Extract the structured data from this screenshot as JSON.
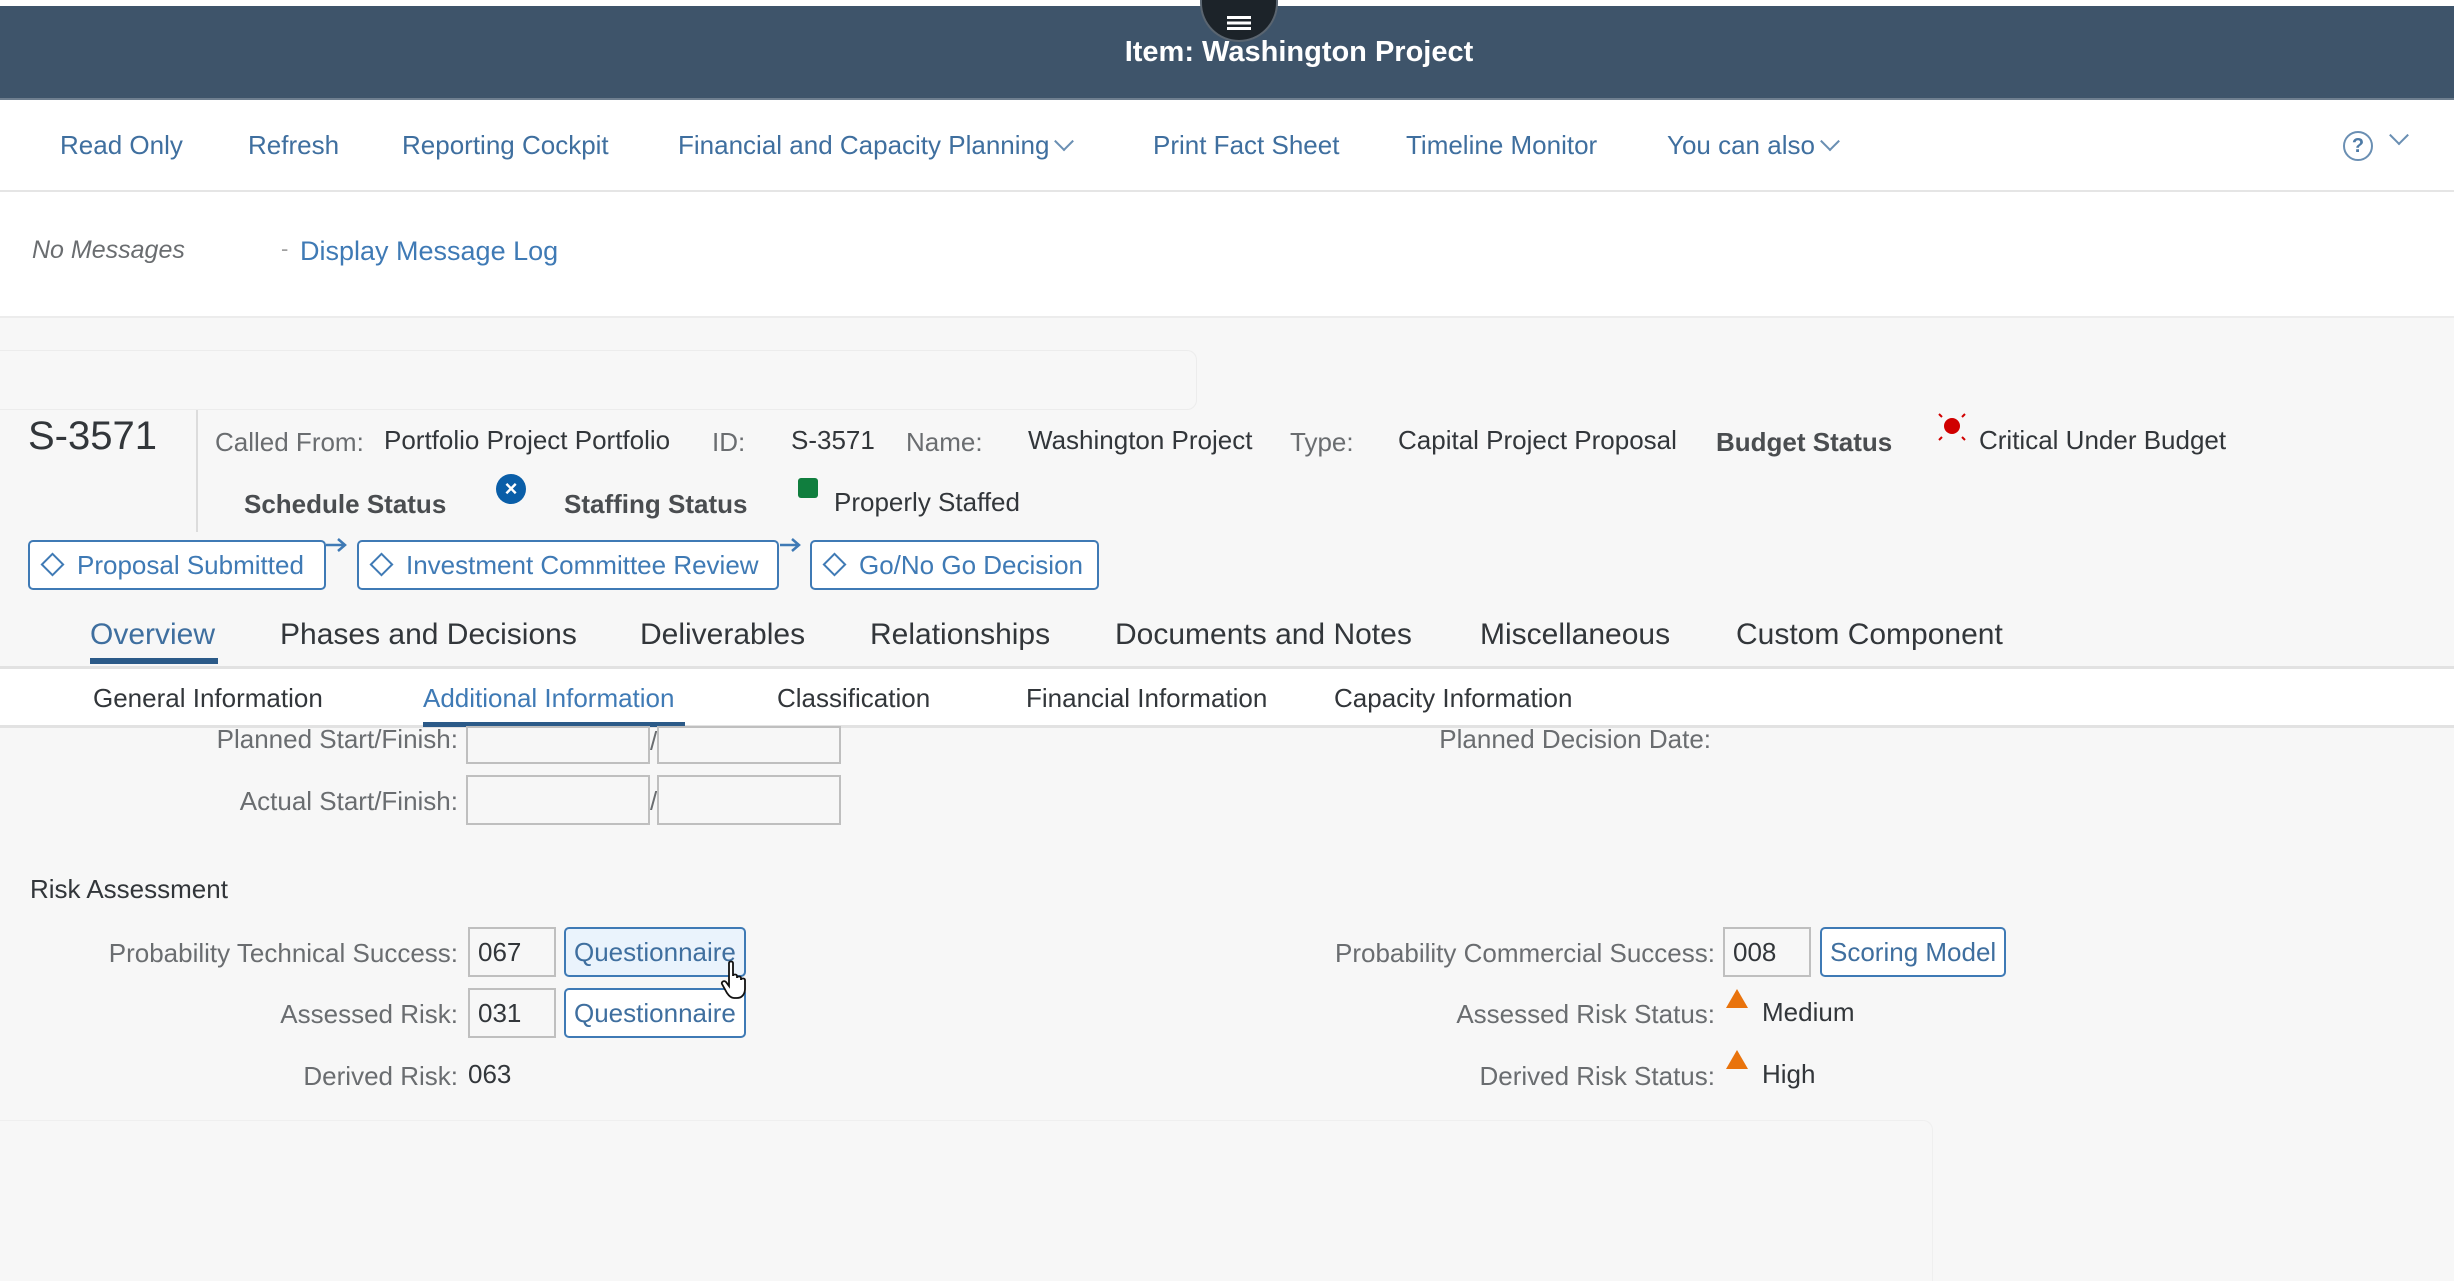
{
  "shell": {
    "title": "Item: Washington Project",
    "menu_icon": "hamburger-menu-icon"
  },
  "toolbar": {
    "items": [
      {
        "label": "Read Only",
        "has_dropdown": false
      },
      {
        "label": "Refresh",
        "has_dropdown": false
      },
      {
        "label": "Reporting Cockpit",
        "has_dropdown": false
      },
      {
        "label": "Financial and Capacity Planning",
        "has_dropdown": true
      },
      {
        "label": "Print Fact Sheet",
        "has_dropdown": false
      },
      {
        "label": "Timeline Monitor",
        "has_dropdown": false
      },
      {
        "label": "You can also",
        "has_dropdown": true
      }
    ],
    "help_icon": "?"
  },
  "messages": {
    "status": "No Messages",
    "separator": "-",
    "log_link": "Display Message Log"
  },
  "object_header": {
    "id_title": "S-3571",
    "called_from_label": "Called From:",
    "called_from_value": "Portfolio Project Portfolio",
    "id_label": "ID:",
    "id_value": "S-3571",
    "name_label": "Name:",
    "name_value": "Washington Project",
    "type_label": "Type:",
    "type_value": "Capital Project Proposal",
    "budget_status_label": "Budget Status",
    "budget_status_value": "Critical Under Budget",
    "schedule_status_label": "Schedule Status",
    "staffing_status_label": "Staffing Status",
    "staffing_status_value": "Properly Staffed",
    "status_colors": {
      "critical": "#d00000",
      "schedule": "#0a5ea8",
      "staffed": "#107e3e",
      "warning": "#e9730c"
    }
  },
  "phases": [
    {
      "label": "Proposal Submitted"
    },
    {
      "label": "Investment Committee Review"
    },
    {
      "label": "Go/No Go Decision"
    }
  ],
  "tabs": [
    {
      "label": "Overview",
      "active": true
    },
    {
      "label": "Phases and Decisions",
      "active": false
    },
    {
      "label": "Deliverables",
      "active": false
    },
    {
      "label": "Relationships",
      "active": false
    },
    {
      "label": "Documents and Notes",
      "active": false
    },
    {
      "label": "Miscellaneous",
      "active": false
    },
    {
      "label": "Custom Component",
      "active": false
    }
  ],
  "subtabs": [
    {
      "label": "General Information",
      "active": false
    },
    {
      "label": "Additional Information",
      "active": true
    },
    {
      "label": "Classification",
      "active": false
    },
    {
      "label": "Financial Information",
      "active": false
    },
    {
      "label": "Capacity Information",
      "active": false
    }
  ],
  "form": {
    "planned_start_finish_label": "Planned Start/Finish:",
    "planned_start": "",
    "planned_finish": "",
    "actual_start_finish_label": "Actual Start/Finish:",
    "actual_start": "",
    "actual_finish": "",
    "date_separator": "/",
    "planned_decision_date_label": "Planned Decision Date:",
    "planned_decision_date": ""
  },
  "risk_assessment": {
    "title": "Risk Assessment",
    "prob_tech_success_label": "Probability Technical Success:",
    "prob_tech_success_value": "067",
    "questionnaire_label": "Questionnaire",
    "assessed_risk_label": "Assessed Risk:",
    "assessed_risk_value": "031",
    "derived_risk_label": "Derived Risk:",
    "derived_risk_value": "063",
    "prob_comm_success_label": "Probability Commercial Success:",
    "prob_comm_success_value": "008",
    "scoring_model_label": "Scoring Model",
    "assessed_risk_status_label": "Assessed Risk Status:",
    "assessed_risk_status_value": "Medium",
    "derived_risk_status_label": "Derived Risk Status:",
    "derived_risk_status_value": "High"
  }
}
